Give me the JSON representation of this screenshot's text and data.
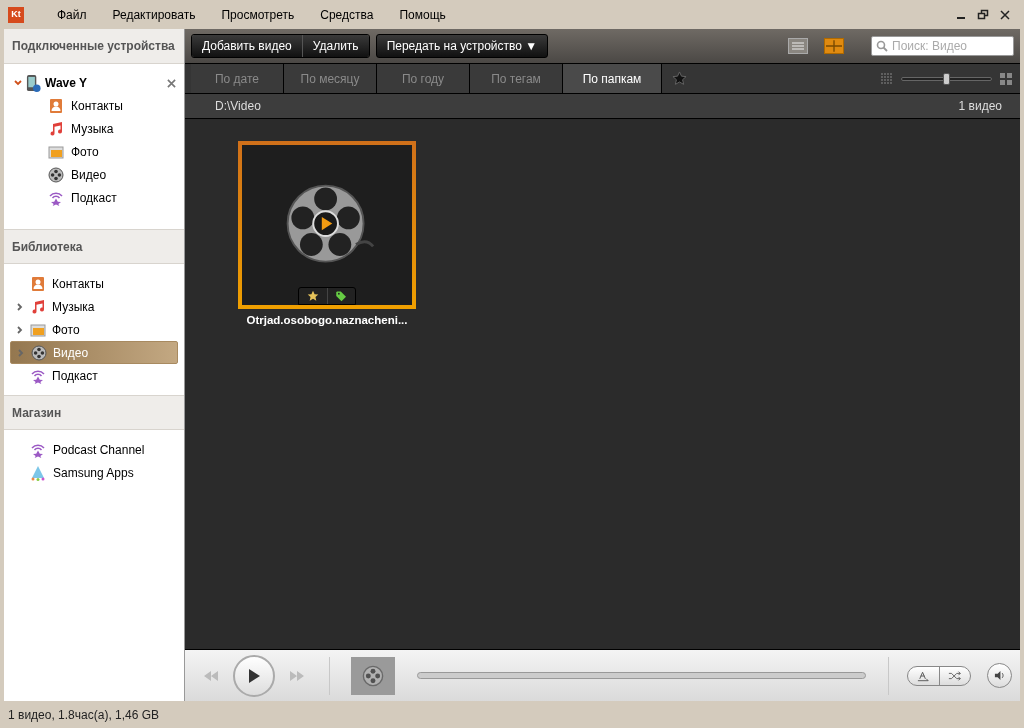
{
  "menu": [
    "Файл",
    "Редактировать",
    "Просмотреть",
    "Средства",
    "Помощь"
  ],
  "logo": "Kt",
  "sidebar": {
    "devices_title": "Подключенные устройства",
    "device": {
      "name": "Wave Y",
      "expanded": true,
      "items": [
        {
          "kind": "contacts",
          "label": "Контакты"
        },
        {
          "kind": "music",
          "label": "Музыка"
        },
        {
          "kind": "photo",
          "label": "Фото"
        },
        {
          "kind": "video",
          "label": "Видео"
        },
        {
          "kind": "podcast",
          "label": "Подкаст"
        }
      ]
    },
    "library_title": "Библиотека",
    "library": [
      {
        "kind": "contacts",
        "label": "Контакты",
        "expandable": false,
        "selected": false
      },
      {
        "kind": "music",
        "label": "Музыка",
        "expandable": true,
        "selected": false
      },
      {
        "kind": "photo",
        "label": "Фото",
        "expandable": true,
        "selected": false
      },
      {
        "kind": "video",
        "label": "Видео",
        "expandable": true,
        "selected": true
      },
      {
        "kind": "podcast",
        "label": "Подкаст",
        "expandable": false,
        "selected": false
      }
    ],
    "store_title": "Магазин",
    "store": [
      {
        "kind": "podcast",
        "label": "Podcast Channel"
      },
      {
        "kind": "apps",
        "label": "Samsung Apps"
      }
    ]
  },
  "toolbar": {
    "buttons": [
      "Добавить видео",
      "Удалить"
    ],
    "transfer": "Передать на устройство ▼",
    "views": [
      {
        "kind": "list",
        "selected": false
      },
      {
        "kind": "grid",
        "selected": true
      }
    ],
    "search": {
      "placeholder": "Поиск: Видео"
    }
  },
  "tabs": [
    {
      "label": "По дате",
      "selected": false
    },
    {
      "label": "По месяцу",
      "selected": false
    },
    {
      "label": "По году",
      "selected": false
    },
    {
      "label": "По тегам",
      "selected": false
    },
    {
      "label": "По папкам",
      "selected": true
    }
  ],
  "zoom": {
    "level": 0.49
  },
  "path": "D:\\Video",
  "count": "1 видео",
  "videos": [
    {
      "title": "Otrjad.osobogo.naznacheni...",
      "selected": true
    }
  ],
  "player": {
    "progress": {
      "level": 0
    }
  },
  "status_bar": "1 видео, 1.8час(а), 1,46 GB"
}
